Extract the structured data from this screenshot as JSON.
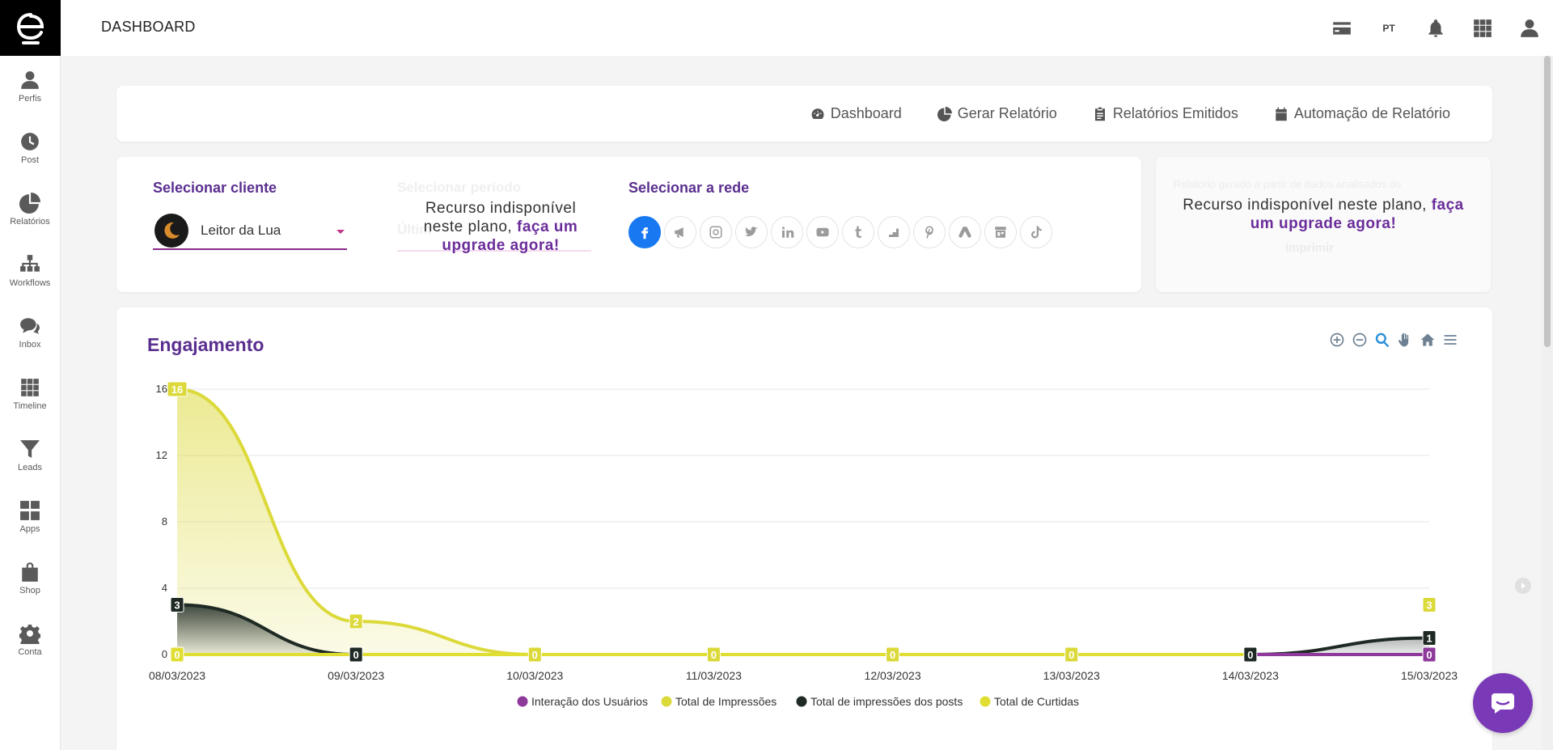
{
  "header": {
    "title": "DASHBOARD",
    "lang": "PT"
  },
  "sidebar": {
    "items": [
      {
        "label": "Perfis",
        "icon": "user-icon"
      },
      {
        "label": "Post",
        "icon": "clock-icon"
      },
      {
        "label": "Relatórios",
        "icon": "pie-chart-icon"
      },
      {
        "label": "Workflows",
        "icon": "sitemap-icon"
      },
      {
        "label": "Inbox",
        "icon": "chat-icon"
      },
      {
        "label": "Timeline",
        "icon": "grid-icon"
      },
      {
        "label": "Leads",
        "icon": "filter-icon"
      },
      {
        "label": "Apps",
        "icon": "apps-icon"
      },
      {
        "label": "Shop",
        "icon": "shopping-bag-icon"
      },
      {
        "label": "Conta",
        "icon": "gear-icon"
      }
    ]
  },
  "tabs": [
    {
      "label": "Dashboard",
      "icon": "speedometer-icon"
    },
    {
      "label": "Gerar Relatório",
      "icon": "pie-chart-icon"
    },
    {
      "label": "Relatórios Emitidos",
      "icon": "clipboard-icon"
    },
    {
      "label": "Automação de Relatório",
      "icon": "calendar-icon"
    }
  ],
  "filters": {
    "client_label": "Selecionar cliente",
    "client_value": "Leitor da Lua",
    "period_label": "Selecionar período",
    "period_value": "Últim",
    "network_label": "Selecionar a rede",
    "networks": [
      "facebook",
      "megaphone",
      "instagram",
      "twitter",
      "linkedin",
      "youtube",
      "tumblr",
      "google-my-business",
      "pinterest",
      "google-ads",
      "store",
      "tiktok"
    ],
    "active_network": "facebook"
  },
  "unavailable": {
    "text": "Recurso indisponível neste plano, ",
    "link": "faça um upgrade agora!"
  },
  "report": {
    "ghost_text": "Relatório gerado a partir de dados analisados do",
    "ghost_button": "Imprimir"
  },
  "colors": {
    "accent": "#5a2f8f",
    "impressions": "#dcd93a",
    "posts": "#1f2a24",
    "interaction": "#8e3a9a",
    "likes": "#e0de33"
  },
  "chart_data": {
    "type": "area",
    "title": "Engajamento",
    "categories": [
      "08/03/2023",
      "09/03/2023",
      "10/03/2023",
      "11/03/2023",
      "12/03/2023",
      "13/03/2023",
      "14/03/2023",
      "15/03/2023"
    ],
    "yticks": [
      "0",
      "4",
      "8",
      "12",
      "16"
    ],
    "ylim": [
      0,
      16
    ],
    "grid": true,
    "legend_position": "bottom",
    "series": [
      {
        "name": "Interação dos Usuários",
        "values": [
          null,
          null,
          null,
          null,
          null,
          null,
          0,
          0
        ],
        "color": "#8e3a9a"
      },
      {
        "name": "Total de Impressões",
        "values": [
          16,
          2,
          0,
          0,
          0,
          0,
          null,
          3
        ],
        "color": "#dcd93a"
      },
      {
        "name": "Total de impressões dos posts",
        "values": [
          3,
          0,
          0,
          0,
          0,
          0,
          0,
          1
        ],
        "color": "#1f2a24"
      },
      {
        "name": "Total de Curtidas",
        "values": [
          0,
          0,
          0,
          0,
          0,
          0,
          0,
          0
        ],
        "color": "#e0de33"
      }
    ]
  }
}
